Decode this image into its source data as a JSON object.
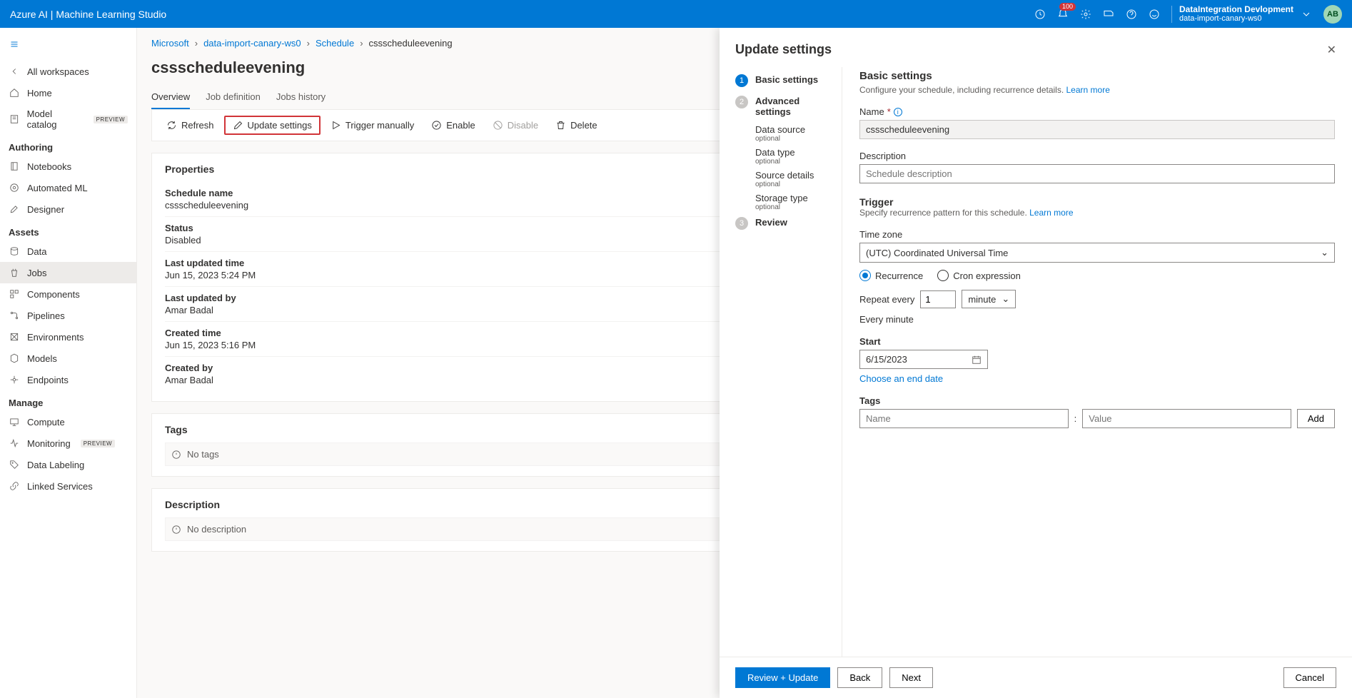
{
  "topbar": {
    "title": "Azure AI | Machine Learning Studio",
    "notif_badge": "100",
    "directory_name": "DataIntegration Devlopment",
    "workspace_name": "data-import-canary-ws0",
    "avatar_initials": "AB"
  },
  "sidebar": {
    "all_workspaces": "All workspaces",
    "home": "Home",
    "model_catalog": "Model catalog",
    "model_catalog_badge": "PREVIEW",
    "authoring_hdr": "Authoring",
    "notebooks": "Notebooks",
    "automated_ml": "Automated ML",
    "designer": "Designer",
    "assets_hdr": "Assets",
    "data": "Data",
    "jobs": "Jobs",
    "components": "Components",
    "pipelines": "Pipelines",
    "environments": "Environments",
    "models": "Models",
    "endpoints": "Endpoints",
    "manage_hdr": "Manage",
    "compute": "Compute",
    "monitoring": "Monitoring",
    "monitoring_badge": "PREVIEW",
    "data_labeling": "Data Labeling",
    "linked_services": "Linked Services"
  },
  "breadcrumbs": {
    "seg0": "Microsoft",
    "seg1": "data-import-canary-ws0",
    "seg2": "Schedule",
    "seg3": "cssscheduleevening"
  },
  "page": {
    "title": "cssscheduleevening",
    "tabs": {
      "overview": "Overview",
      "jobdef": "Job definition",
      "jobhist": "Jobs history"
    },
    "actions": {
      "refresh": "Refresh",
      "update": "Update settings",
      "trigger": "Trigger manually",
      "enable": "Enable",
      "disable": "Disable",
      "delete": "Delete"
    }
  },
  "properties": {
    "heading": "Properties",
    "items": {
      "schedule_name_l": "Schedule name",
      "schedule_name_v": "cssscheduleevening",
      "status_l": "Status",
      "status_v": "Disabled",
      "last_updated_time_l": "Last updated time",
      "last_updated_time_v": "Jun 15, 2023 5:24 PM",
      "last_updated_by_l": "Last updated by",
      "last_updated_by_v": "Amar Badal",
      "created_time_l": "Created time",
      "created_time_v": "Jun 15, 2023 5:16 PM",
      "created_by_l": "Created by",
      "created_by_v": "Amar Badal"
    },
    "tags_hdr": "Tags",
    "no_tags": "No tags",
    "desc_hdr": "Description",
    "no_desc": "No description"
  },
  "panel": {
    "title": "Update settings",
    "steps": {
      "basic": "Basic settings",
      "advanced": "Advanced settings",
      "data_source": "Data source",
      "data_type": "Data type",
      "source_details": "Source details",
      "storage_type": "Storage type",
      "optional": "optional",
      "review": "Review"
    },
    "form": {
      "basic_hdr": "Basic settings",
      "basic_desc": "Configure your schedule, including recurrence details. ",
      "learn_more": "Learn more",
      "name_lbl": "Name",
      "name_val": "cssscheduleevening",
      "desc_lbl": "Description",
      "desc_ph": "Schedule description",
      "trigger_hdr": "Trigger",
      "trigger_desc": "Specify recurrence pattern for this schedule. ",
      "tz_lbl": "Time zone",
      "tz_val": "(UTC) Coordinated Universal Time",
      "recurrence": "Recurrence",
      "cron": "Cron expression",
      "repeat_lbl": "Repeat every",
      "repeat_val": "1",
      "repeat_unit": "minute",
      "repeat_summary": "Every minute",
      "start_lbl": "Start",
      "start_val": "6/15/2023",
      "choose_end": "Choose an end date",
      "tags_lbl": "Tags",
      "tag_name_ph": "Name",
      "tag_value_ph": "Value",
      "add": "Add"
    },
    "footer": {
      "review_update": "Review + Update",
      "back": "Back",
      "next": "Next",
      "cancel": "Cancel"
    }
  }
}
